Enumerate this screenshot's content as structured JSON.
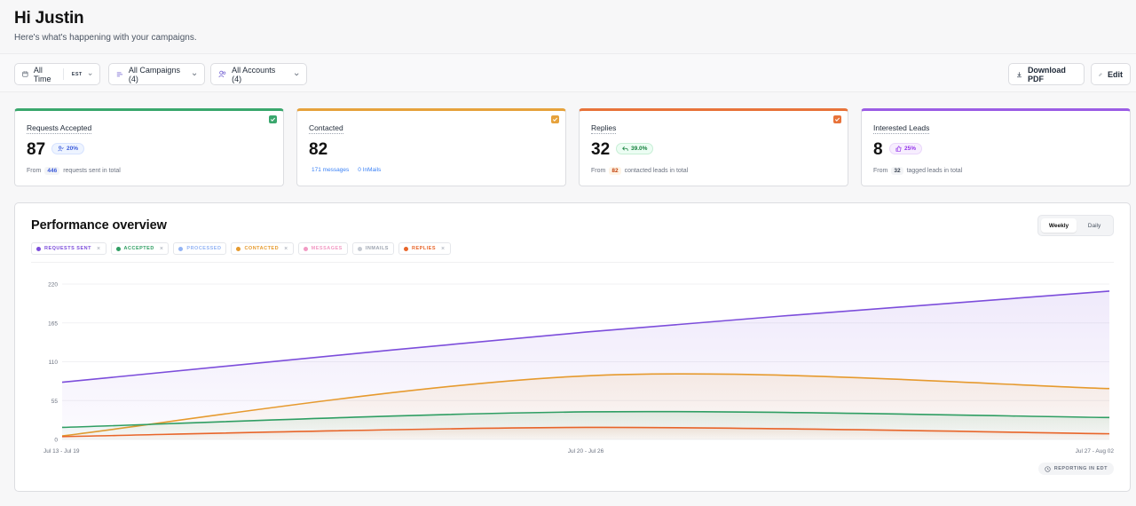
{
  "header": {
    "greeting": "Hi Justin",
    "subtitle": "Here's what's happening with your campaigns."
  },
  "toolbar": {
    "time_filter": "All Time",
    "timezone": "EST",
    "campaign_filter": "All Campaigns (4)",
    "account_filter": "All Accounts (4)",
    "download_label": "Download PDF",
    "edit_label": "Edit"
  },
  "cards": [
    {
      "title": "Requests Accepted",
      "value": "87",
      "badge": "20%",
      "foot_prefix": "From",
      "foot_count": "446",
      "foot_suffix": "requests sent in total",
      "color": "#3aa76d",
      "checked": true
    },
    {
      "title": "Contacted",
      "value": "82",
      "link1": "171 messages",
      "link2": "0 InMails",
      "color": "#e6a23c",
      "checked": true
    },
    {
      "title": "Replies",
      "value": "32",
      "badge": "39.0%",
      "foot_prefix": "From",
      "foot_count": "82",
      "foot_suffix": "contacted leads in total",
      "color": "#e8733a",
      "checked": true
    },
    {
      "title": "Interested Leads",
      "value": "8",
      "badge": "25%",
      "foot_prefix": "From",
      "foot_count": "32",
      "foot_suffix": "tagged leads in total",
      "color": "#9b5de5",
      "checked": false
    }
  ],
  "panel": {
    "title": "Performance overview",
    "toggle": [
      "Weekly",
      "Daily"
    ],
    "active_toggle": "Weekly",
    "footnote": "REPORTING IN EDT"
  },
  "legend": [
    {
      "label": "REQUESTS SENT",
      "color": "#7c4ddb",
      "active": true
    },
    {
      "label": "ACCEPTED",
      "color": "#2f9e63",
      "active": true
    },
    {
      "label": "PROCESSED",
      "color": "#93b4f5",
      "active": false
    },
    {
      "label": "CONTACTED",
      "color": "#e69a2e",
      "active": true
    },
    {
      "label": "MESSAGES",
      "color": "#f29ac4",
      "active": false
    },
    {
      "label": "INMAILS",
      "color": "#9ca3af",
      "active": false
    },
    {
      "label": "REPLIES",
      "color": "#e8652a",
      "active": true
    }
  ],
  "chart_data": {
    "type": "line",
    "categories": [
      "Jul 13 - Jul 19",
      "Jul 20 - Jul 26",
      "Jul 27 - Aug 02"
    ],
    "yticks": [
      0,
      55,
      110,
      165,
      220
    ],
    "ylim": [
      0,
      220
    ],
    "series": [
      {
        "name": "REQUESTS SENT",
        "values": [
          81,
          152,
          210
        ],
        "color": "#7c4ddb"
      },
      {
        "name": "CONTACTED",
        "values": [
          5,
          90,
          72
        ],
        "color": "#e69a2e"
      },
      {
        "name": "ACCEPTED",
        "values": [
          17,
          39,
          31
        ],
        "color": "#2f9e63"
      },
      {
        "name": "REPLIES",
        "values": [
          4,
          17,
          8
        ],
        "color": "#e8652a"
      }
    ]
  }
}
